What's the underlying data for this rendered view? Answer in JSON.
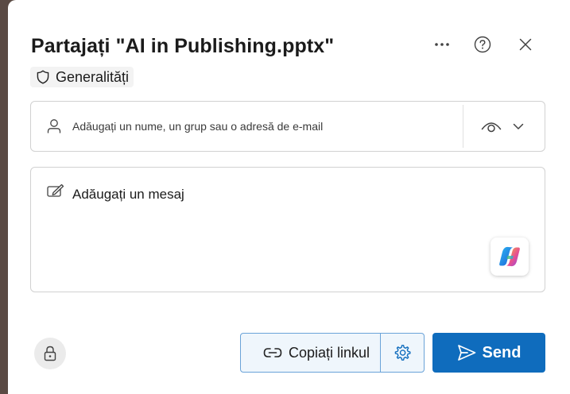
{
  "dialog": {
    "title": "Partajați \"AI in Publishing.pptx\"",
    "header_icons": [
      "more-icon",
      "help-icon",
      "close-icon"
    ],
    "sensitivity_label": "Generalități"
  },
  "recipients": {
    "placeholder": "Adăugați un nume, un grup sau o adresă de e-mail",
    "value": "",
    "permission_icon": "eye-icon"
  },
  "message": {
    "placeholder": "Adăugați un mesaj",
    "value": ""
  },
  "footer": {
    "copy_link_label": "Copiați linkul",
    "send_label": "Send"
  },
  "colors": {
    "accent": "#0f6cbd",
    "copy_border": "#6aa3d8",
    "copy_background": "#eff6fc"
  }
}
